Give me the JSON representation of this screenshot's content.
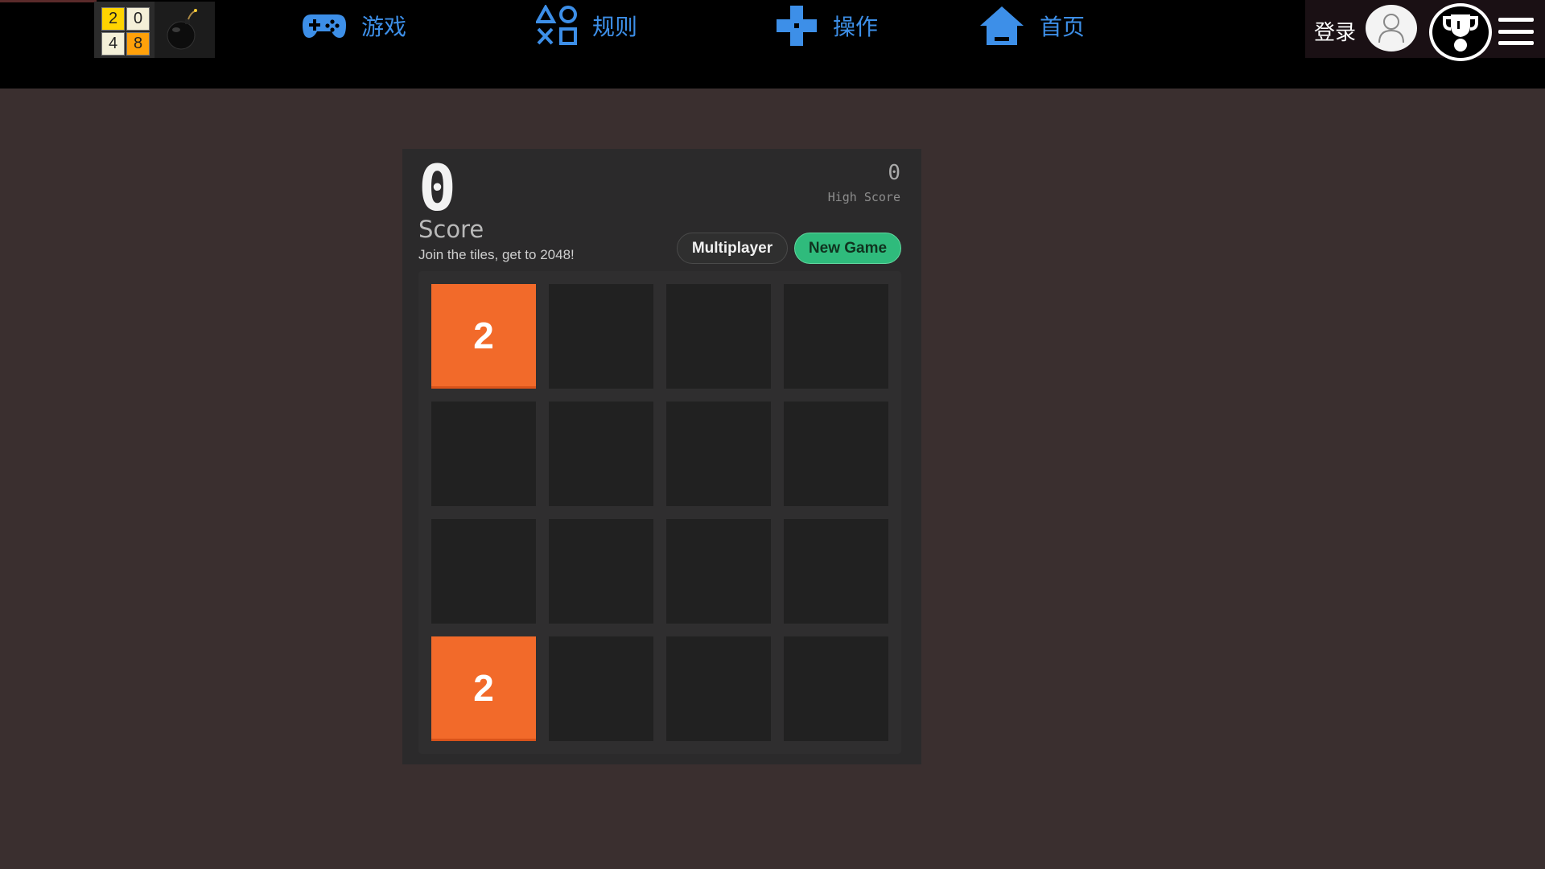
{
  "logo": {
    "tiles": [
      "2",
      "0",
      "4",
      "8"
    ],
    "icon": "bomb-icon"
  },
  "nav": [
    {
      "label": "游戏",
      "icon": "gamepad-icon"
    },
    {
      "label": "规则",
      "icon": "playstation-shapes-icon"
    },
    {
      "label": "操作",
      "icon": "dpad-icon"
    },
    {
      "label": "首页",
      "icon": "home-icon"
    }
  ],
  "account": {
    "login_label": "登录",
    "avatar_icon": "user-icon",
    "trophy_icon": "trophy-icon",
    "menu_icon": "hamburger-menu-icon"
  },
  "game": {
    "score": "0",
    "score_label": "Score",
    "tagline": "Join the tiles, get to 2048!",
    "high_score": "0",
    "high_score_label": "High Score",
    "multiplayer_label": "Multiplayer",
    "new_game_label": "New Game",
    "grid": [
      [
        "2",
        "",
        "",
        ""
      ],
      [
        "",
        "",
        "",
        ""
      ],
      [
        "",
        "",
        "",
        ""
      ],
      [
        "2",
        "",
        "",
        ""
      ]
    ]
  },
  "colors": {
    "background": "#3a2f2f",
    "nav_accent": "#3d8fe8",
    "tile_2": "#f26a2a",
    "new_game_button": "#2fbb7c"
  }
}
